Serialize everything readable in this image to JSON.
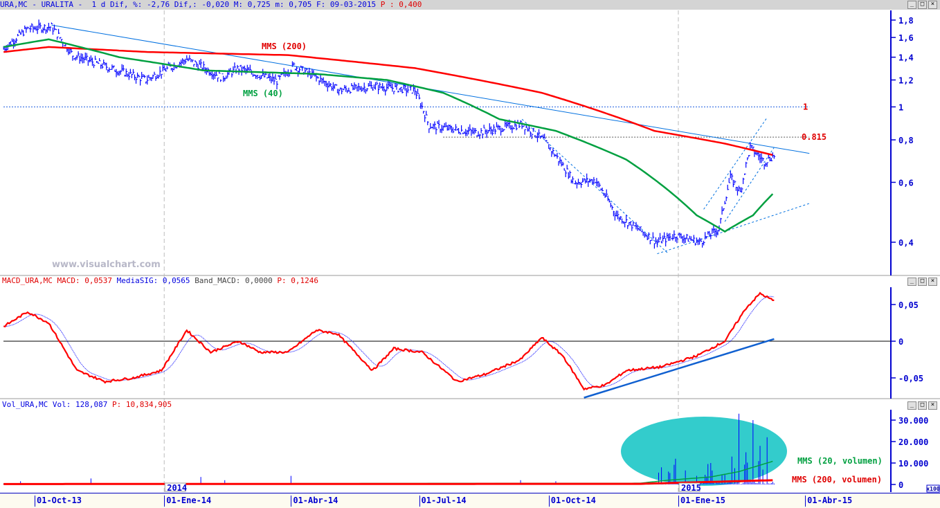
{
  "header": {
    "symbol": "URA,MC - URALITA -",
    "period": "1 d",
    "dif_pct": "Dif, %: -2,76",
    "dif": "Dif,: -0,020",
    "max": "M: 0,725",
    "min": "m: 0,705",
    "date": "F: 09-03-2015",
    "p": "P : 0,400"
  },
  "macd_header": {
    "name": "MACD_URA,MC",
    "macd": "MACD: 0,0537",
    "sig": "MediaSIG: 0,0565",
    "band": "Band_MACD: 0,0000",
    "p": "P: 0,1246"
  },
  "vol_header": {
    "name": "Vol_URA,MC",
    "vol": "Vol: 128,087",
    "p": "P: 10,834,905"
  },
  "window_buttons": [
    "_",
    "□",
    "×"
  ],
  "watermark": "www.visualchart.com",
  "x_axis": {
    "labels": [
      "01-Oct-13",
      "01-Ene-14",
      "01-Abr-14",
      "01-Jul-14",
      "01-Oct-14",
      "01-Ene-15",
      "01-Abr-15"
    ],
    "label_days": [
      0,
      92,
      182,
      273,
      365,
      457,
      547
    ],
    "years": [
      "2014",
      "2015"
    ],
    "year_days": [
      92,
      457
    ]
  },
  "colors": {
    "price": "#0000ff",
    "mms200": "#ff0000",
    "mms40": "#00a040",
    "trend": "#0070e0",
    "macd": "#ff0000",
    "signal": "#0000ff",
    "ellipse": "#33cccc",
    "axis": "#0000d0"
  },
  "chart_data": [
    {
      "type": "line",
      "title": "URA,MC - URALITA - 1 d",
      "y_scale": "log",
      "ylim": [
        0.35,
        1.9
      ],
      "y_ticks": [
        "1,8",
        "1,6",
        "1,4",
        "1,2",
        "1",
        "0,8",
        "0,6",
        "0,4"
      ],
      "y_tick_values": [
        1.8,
        1.6,
        1.4,
        1.2,
        1,
        0.8,
        0.6,
        0.4
      ],
      "x_unit": "days since 01-Oct-13",
      "price": {
        "x": [
          -22,
          -5,
          12,
          27,
          54,
          79,
          108,
          133,
          145,
          172,
          184,
          216,
          241,
          270,
          280,
          314,
          346,
          361,
          383,
          398,
          413,
          442,
          455,
          472,
          486,
          494,
          501,
          508,
          518,
          525
        ],
        "y": [
          1.48,
          1.7,
          1.72,
          1.42,
          1.3,
          1.2,
          1.38,
          1.22,
          1.3,
          1.19,
          1.32,
          1.12,
          1.15,
          1.12,
          0.88,
          0.84,
          0.89,
          0.8,
          0.6,
          0.61,
          0.48,
          0.4,
          0.42,
          0.4,
          0.44,
          0.62,
          0.56,
          0.76,
          0.69,
          0.72
        ]
      },
      "series": [
        {
          "name": "MMS (200)",
          "x": [
            -22,
            10,
            80,
            180,
            270,
            360,
            440,
            490,
            525
          ],
          "y": [
            1.45,
            1.5,
            1.45,
            1.42,
            1.3,
            1.1,
            0.85,
            0.78,
            0.72
          ]
        },
        {
          "name": "MMS (40)",
          "x": [
            -22,
            10,
            60,
            120,
            200,
            250,
            290,
            330,
            370,
            420,
            470,
            490,
            510,
            525
          ],
          "y": [
            1.5,
            1.58,
            1.4,
            1.28,
            1.25,
            1.2,
            1.1,
            0.92,
            0.85,
            0.7,
            0.48,
            0.43,
            0.48,
            0.56
          ]
        }
      ],
      "annotations": [
        {
          "text": "1",
          "level": 1
        },
        {
          "text": "0.815",
          "level": 0.815
        }
      ],
      "trendlines": [
        {
          "x": [
            12,
            550
          ],
          "y": [
            1.74,
            0.73
          ]
        },
        {
          "x": [
            442,
            550
          ],
          "y": [
            0.37,
            0.52
          ]
        },
        {
          "x": [
            346,
            450
          ],
          "y": [
            0.92,
            0.37
          ]
        },
        {
          "x": [
            475,
            520
          ],
          "y": [
            0.5,
            0.93
          ]
        },
        {
          "x": [
            490,
            525
          ],
          "y": [
            0.46,
            0.76
          ]
        }
      ]
    },
    {
      "type": "line",
      "title": "MACD_URA,MC",
      "ylim": [
        -0.08,
        0.07
      ],
      "y_ticks": [
        "0,05",
        "0",
        "-0,05"
      ],
      "y_tick_values": [
        0.05,
        0,
        -0.05
      ],
      "series": [
        {
          "name": "MACD",
          "x": [
            -22,
            -5,
            10,
            30,
            50,
            70,
            90,
            108,
            125,
            145,
            160,
            180,
            200,
            215,
            240,
            255,
            275,
            300,
            320,
            345,
            360,
            375,
            390,
            405,
            420,
            445,
            470,
            490,
            505,
            515,
            525
          ],
          "y": [
            0.02,
            0.04,
            0.025,
            -0.04,
            -0.055,
            -0.05,
            -0.04,
            0.015,
            -0.015,
            0.0,
            -0.015,
            -0.015,
            0.015,
            0.01,
            -0.04,
            -0.01,
            -0.015,
            -0.055,
            -0.045,
            -0.025,
            0.005,
            -0.02,
            -0.065,
            -0.06,
            -0.04,
            -0.035,
            -0.02,
            0.0,
            0.045,
            0.065,
            0.055
          ]
        },
        {
          "name": "MediaSIG",
          "lag": 6
        }
      ],
      "trendline": {
        "x": [
          390,
          525
        ],
        "y": [
          -0.077,
          0.003
        ]
      }
    },
    {
      "type": "bar",
      "title": "Vol_URA,MC",
      "ylim": [
        0,
        33000
      ],
      "y_ticks": [
        "30.000",
        "20.000",
        "10.000",
        "0"
      ],
      "y_tick_values": [
        30000,
        20000,
        10000,
        0
      ],
      "multiplier": "x100",
      "spikes": {
        "x": [
          -10,
          40,
          118,
          135,
          182,
          345,
          370,
          445,
          450,
          455,
          470,
          480,
          490,
          495,
          500,
          505,
          510,
          515,
          520
        ],
        "y": [
          1500,
          2800,
          3500,
          2000,
          4000,
          2000,
          1500,
          8000,
          6000,
          12000,
          4000,
          10000,
          5000,
          13000,
          33000,
          15000,
          30000,
          18000,
          22000
        ]
      },
      "series": [
        {
          "name": "MMS (20, volumen)",
          "x": [
            -22,
            430,
            450,
            480,
            500,
            525
          ],
          "y": [
            300,
            600,
            2000,
            3500,
            6000,
            11000
          ]
        },
        {
          "name": "MMS (200, volumen)",
          "x": [
            -22,
            430,
            525
          ],
          "y": [
            200,
            300,
            2000
          ]
        }
      ]
    }
  ]
}
